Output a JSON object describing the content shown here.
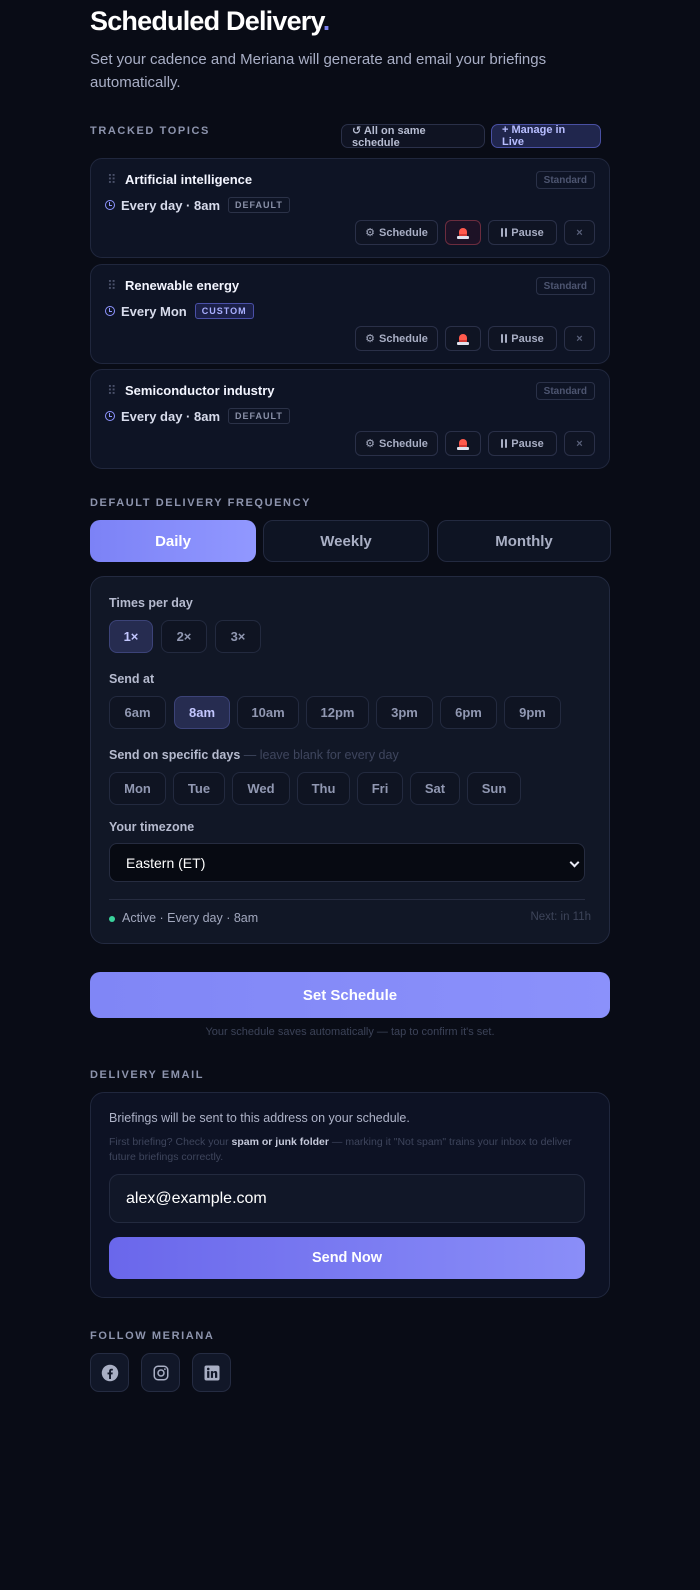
{
  "header": {
    "title": "Scheduled Delivery",
    "title_dot": ".",
    "subtitle": "Set your cadence and Meriana will generate and email your briefings automatically."
  },
  "topics_section": {
    "label": "TRACKED TOPICS",
    "same_schedule_label": "↺ All on same schedule",
    "manage_label": "+ Manage in Live",
    "topics": [
      {
        "name": "Artificial intelligence",
        "plan": "Standard",
        "schedule": "Every day · 8am",
        "tag": "DEFAULT"
      },
      {
        "name": "Renewable energy",
        "plan": "Standard",
        "schedule": "Every Mon",
        "tag": "CUSTOM"
      },
      {
        "name": "Semiconductor industry",
        "plan": "Standard",
        "schedule": "Every day · 8am",
        "tag": "DEFAULT"
      }
    ],
    "actions": {
      "schedule": "Schedule",
      "pause": "Pause",
      "remove": "×"
    }
  },
  "frequency": {
    "label": "DEFAULT DELIVERY FREQUENCY",
    "tabs": [
      "Daily",
      "Weekly",
      "Monthly"
    ],
    "selected": "Daily"
  },
  "settings": {
    "times_label": "Times per day",
    "times": [
      "1×",
      "2×",
      "3×"
    ],
    "times_selected": "1×",
    "send_at_label": "Send at",
    "send_at": [
      "6am",
      "8am",
      "10am",
      "12pm",
      "3pm",
      "6pm",
      "9pm"
    ],
    "send_at_selected": "8am",
    "days_label": "Send on specific days",
    "days_hint": " — leave blank for every day",
    "days": [
      "Mon",
      "Tue",
      "Wed",
      "Thu",
      "Fri",
      "Sat",
      "Sun"
    ],
    "timezone_label": "Your timezone",
    "timezone_value": "Eastern (ET)",
    "status": "Active · Every day · 8am",
    "next": "Next: in 11h"
  },
  "set_schedule": {
    "label": "Set Schedule",
    "hint": "Your schedule saves automatically — tap to confirm it's set."
  },
  "email": {
    "label": "DELIVERY EMAIL",
    "description": "Briefings will be sent to this address on your schedule.",
    "tip_pre": "First briefing? Check your ",
    "tip_bold": "spam or junk folder",
    "tip_post": " — marking it \"Not spam\" trains your inbox to deliver future briefings correctly.",
    "value": "alex@example.com",
    "send_label": "Send Now"
  },
  "follow": {
    "label": "FOLLOW MERIANA",
    "icons": [
      "facebook-icon",
      "instagram-icon",
      "linkedin-icon"
    ]
  },
  "colors": {
    "background": "#090c16",
    "accent": "#7c82f6",
    "active_dot": "#3ad39c"
  }
}
